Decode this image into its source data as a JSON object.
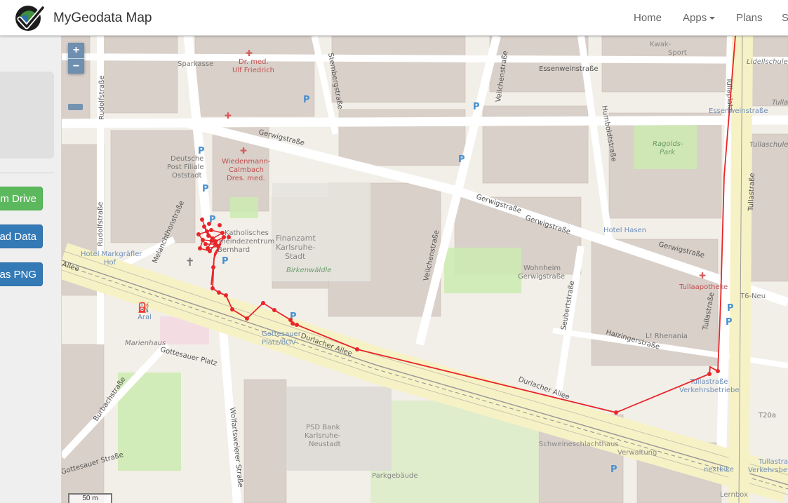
{
  "app": {
    "title": "MyGeodata Map"
  },
  "nav": {
    "home": "Home",
    "apps": "Apps",
    "plans": "Plans",
    "more": "S"
  },
  "sidebar": {
    "buttons": [
      {
        "label": "om Drive",
        "style": "green"
      },
      {
        "label": "ad Data",
        "style": "blue"
      },
      {
        "label": "d as PNG",
        "style": "blue"
      }
    ]
  },
  "map": {
    "zoom_in": "+",
    "zoom_out": "−",
    "scale": "50 m",
    "labels": {
      "sparkasse": "Sparkasse",
      "dr_med": "Dr. med.",
      "ulf": "Ulf Friedrich",
      "deutsche_post": "Deutsche",
      "post_filiale": "Post Filiale",
      "oststadt": "Oststadt",
      "wiedenmann": "Wiedenmann-",
      "calmbach": "Calmbach",
      "dres": "Dres. med.",
      "finanzamt": "Finanzamt",
      "karlsruhe": "Karlsruhe-",
      "stadt": "Stadt",
      "birkenwaeldle": "Birkenwäldle",
      "katholisches": "Katholisches",
      "gemeindezentrum": "Gemeindezentrum",
      "bernhard": "Bernhard",
      "hotel_markgraefler": "Hotel Markgräfler",
      "hof": "Hof",
      "aral": "Aral",
      "marienhaus": "Marienhaus",
      "gottesauer_platz_bgv": "Gottesauer",
      "platz_bgv": "Platz/BGV",
      "wohnheim": "Wohnheim",
      "gerwigstrasse_small": "Gerwigstraße",
      "hotel_hasen": "Hotel Hasen",
      "tullaapotheke": "Tullaapotheke",
      "l_rhenania": "L! Rhenania",
      "psd_bank": "PSD Bank",
      "psd_karlsruhe": "Karlsruhe-",
      "neustadt": "Neustadt",
      "parkgebaeude": "Parkgebäude",
      "schweineschlachthaus": "Schweineschlachthaus",
      "verwaltung": "Verwaltung",
      "nextbike": "nextbike",
      "lernbox": "Lernbox",
      "tullastrasse_vb": "Tullastraße",
      "verkehrsbetriebe": "Verkehrsbetriebe",
      "kwik": "Kwak-",
      "sport": "Sport",
      "lidellschule": "Lidellschule",
      "essenweinstrasse2": "Essenweinstraße",
      "ragolds": "Ragolds-",
      "park": "Park",
      "tullaschule": "Tullaschule",
      "tullas": "Tullas",
      "t6_neu": "T6-Neu",
      "t20a": "T20a",
      "tullastr_vb2": "Tullastra",
      "verkehrsbet2": "Verkehrsbet"
    },
    "streets": {
      "gerwig_1": "Gerwigstraße",
      "gerwig_2": "Gerwigstraße",
      "gerwig_3": "Gerwigstraße",
      "gerwig_4": "Gerwigstraße",
      "durlacher_1": "Durlacher Allee",
      "durlacher_2": "Durlacher Allee",
      "durlacher_3": "Allee",
      "essenwein": "Essenweinstraße",
      "rudolf_1": "Rudolfstraße",
      "rudolf_2": "Rudolfstraße",
      "melanchthon": "Melanchthonstraße",
      "veilchen_1": "Veilchenstraße",
      "veilchen_2": "Veilchenstraße",
      "humboldt": "Humboldtstraße",
      "seubert": "Seubertstraße",
      "haizinger": "Haizingerstraße",
      "tulla_1": "Tullaplatz",
      "tulla_2": "Tullastraße",
      "tulla_3": "Tullastraße",
      "tulla_4": "Tullastraße",
      "sternberg": "Sternbergstraße",
      "gottesauer_platz": "Gottesauer Platz",
      "gottesauer_str": "Gottesauer Straße",
      "wolfartsweierer": "Wolfartsweierer Straße",
      "burbach": "Burbachstraße",
      "durlacher_left": "Allee"
    },
    "colors": {
      "route": "#e8262a",
      "accent": "#6e8fb0"
    }
  }
}
